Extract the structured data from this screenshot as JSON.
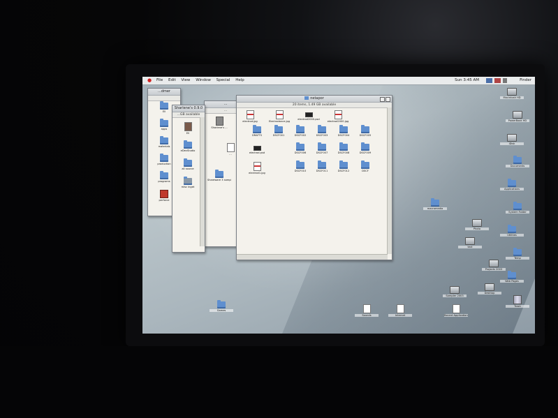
{
  "menubar": {
    "items": [
      "File",
      "Edit",
      "View",
      "Window",
      "Special",
      "Help"
    ],
    "clock": "Sun 3:45 AM",
    "app": "Finder"
  },
  "windows": {
    "back1": {
      "title": "...dmer"
    },
    "back2": {
      "title": "Sharlene's 0.9.0",
      "status": "...GB available"
    },
    "back3": {
      "title": "...",
      "status": "..."
    },
    "front": {
      "title": "netapor",
      "status": "20 items, 1.49 GB available"
    }
  },
  "front_items": [
    {
      "label": "electrod.jpg",
      "kind": "jpg"
    },
    {
      "label": "Electrodance.jpg",
      "kind": "jpg"
    },
    {
      "label": "electrod2000.psd",
      "kind": "psd"
    },
    {
      "label": "electrod2000.jpg",
      "kind": "jpg"
    },
    {
      "label": "DRAFTS",
      "kind": "folder"
    },
    {
      "label": "DSCF001",
      "kind": "folder"
    },
    {
      "label": "DSCF002",
      "kind": "folder"
    },
    {
      "label": "DSCF003",
      "kind": "folder"
    },
    {
      "label": "DSCF004",
      "kind": "folder"
    },
    {
      "label": "DSCF005",
      "kind": "folder"
    },
    {
      "label": "electrod.psd",
      "kind": "psd"
    },
    {
      "label": "DSCF006",
      "kind": "folder"
    },
    {
      "label": "DSCF007",
      "kind": "folder"
    },
    {
      "label": "DSCF008",
      "kind": "folder"
    },
    {
      "label": "DSCF009",
      "kind": "folder"
    },
    {
      "label": "electrod1.jpg",
      "kind": "jpg"
    },
    {
      "label": "DSCF010",
      "kind": "folder"
    },
    {
      "label": "DSCF011",
      "kind": "folder"
    },
    {
      "label": "DSCF012",
      "kind": "folder"
    },
    {
      "label": "DSCF",
      "kind": "folder"
    }
  ],
  "back1_items": [
    "Ell",
    "apps",
    "materials",
    "production",
    "programs",
    "perforce"
  ],
  "back2_items": [
    "Ell",
    "eDevStudio",
    "all source",
    "misc inget"
  ],
  "back3_items": [
    "Sharlene's ...",
    "...",
    "Shareware 3 samples"
  ],
  "desktop_icons": {
    "right": [
      "Macintosh HD",
      "PowerBook HD",
      "iDisk",
      "Documents",
      "Applications",
      "System Folder",
      "Utilities",
      "Temp",
      "Web Pages",
      "Trash"
    ],
    "middle": [
      "macromedia",
      "Photo",
      "text",
      "Projects 2003"
    ],
    "bottom": [
      "Games",
      "Sounds",
      "Internet",
      "Sampler 2003",
      "Desktop",
      "Recent Applications"
    ]
  }
}
